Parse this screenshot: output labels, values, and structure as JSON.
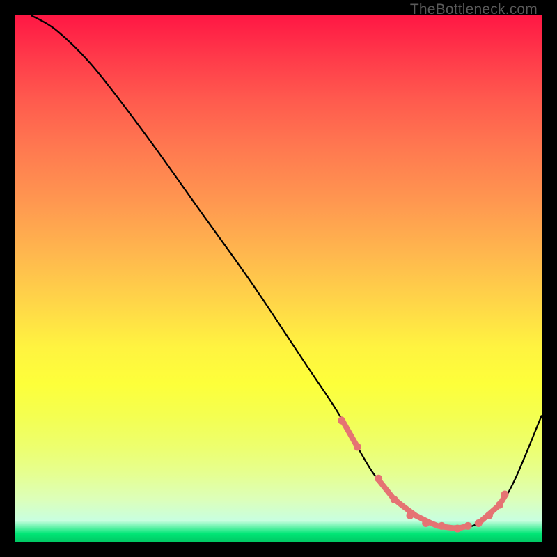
{
  "watermark": "TheBottleneck.com",
  "chart_data": {
    "type": "line",
    "title": "",
    "xlabel": "",
    "ylabel": "",
    "xlim": [
      0,
      100
    ],
    "ylim": [
      0,
      100
    ],
    "grid": false,
    "series": [
      {
        "name": "curve",
        "x": [
          3,
          8,
          15,
          25,
          35,
          45,
          55,
          61,
          65,
          68,
          72,
          76,
          80,
          84,
          88,
          92,
          95,
          100
        ],
        "values": [
          100,
          97,
          90,
          77,
          63,
          49,
          34,
          25,
          18,
          13,
          8,
          5,
          3,
          2.5,
          3.5,
          7,
          12,
          24
        ]
      }
    ],
    "highlight_ranges": [
      {
        "x_start": 62,
        "x_end": 65
      },
      {
        "x_start": 69,
        "x_end": 86
      },
      {
        "x_start": 88,
        "x_end": 93
      }
    ],
    "dots": [
      {
        "x": 62,
        "y": 23
      },
      {
        "x": 65,
        "y": 18
      },
      {
        "x": 69,
        "y": 12
      },
      {
        "x": 72,
        "y": 8
      },
      {
        "x": 75,
        "y": 5
      },
      {
        "x": 78,
        "y": 3.5
      },
      {
        "x": 81,
        "y": 3
      },
      {
        "x": 84,
        "y": 2.5
      },
      {
        "x": 86,
        "y": 3
      },
      {
        "x": 88,
        "y": 3.5
      },
      {
        "x": 90,
        "y": 5
      },
      {
        "x": 92,
        "y": 7
      },
      {
        "x": 93,
        "y": 9
      }
    ]
  }
}
